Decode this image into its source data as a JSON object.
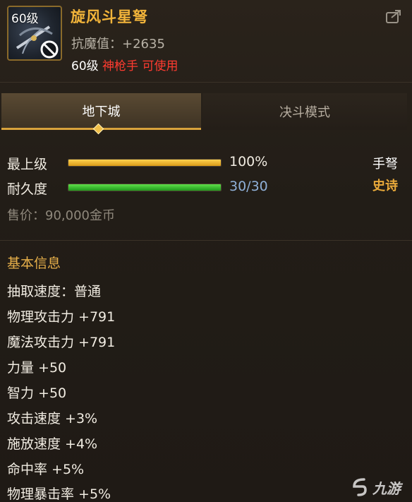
{
  "item": {
    "level_badge": "60级",
    "name": "旋风斗星弩",
    "resist": "抗魔值：+2635",
    "req_level": "60级",
    "req_class": "神枪手 可使用"
  },
  "tabs": [
    {
      "label": "地下城",
      "active": true
    },
    {
      "label": "决斗模式",
      "active": false
    }
  ],
  "stats": {
    "max_level_label": "最上级",
    "max_level_value": "100%",
    "max_level_fraction": 1.0,
    "durability_label": "耐久度",
    "durability_value": "30/30",
    "durability_fraction": 1.0,
    "type": "手弩",
    "rarity": "史诗",
    "price": "售价：90,000金币"
  },
  "basic_info": {
    "title": "基本信息",
    "attributes": [
      "抽取速度：普通",
      "物理攻击力 +791",
      "魔法攻击力 +791",
      "力量 +50",
      "智力 +50",
      "攻击速度 +3%",
      "施放速度 +4%",
      "命中率 +5%",
      "物理暴击率 +5%"
    ]
  },
  "watermark": {
    "text": "九游"
  },
  "colors": {
    "name": "#f2b43a",
    "class_req": "#ff3b30",
    "rarity": "#e8a93a",
    "section_title": "#e8b04a",
    "durability_value": "#8fb0d8"
  },
  "icons": [
    "crossbow-icon",
    "no-use-icon",
    "share-icon",
    "tab-selected-diamond-icon",
    "watermark-logo-icon"
  ]
}
